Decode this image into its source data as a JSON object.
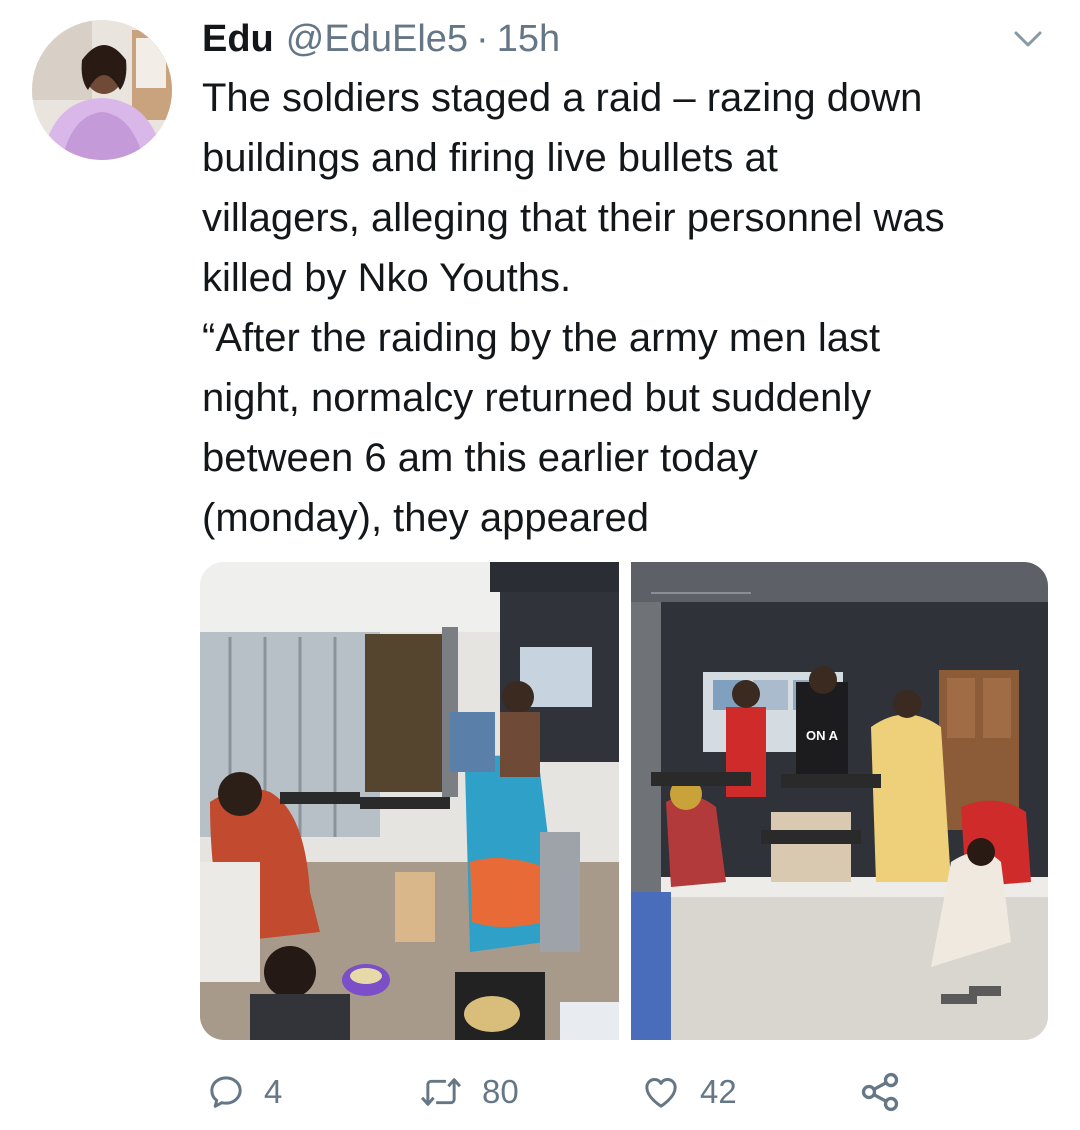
{
  "tweet": {
    "display_name": "Edu",
    "handle": "@EduEle5",
    "separator": "·",
    "time": "15h",
    "lines": [
      "The soldiers staged a raid – razing down",
      "buildings and firing live bullets at",
      "villagers, alleging that their personnel was",
      "killed by Nko Youths.",
      "“After the raiding by the army men last",
      "night, normalcy returned but suddenly",
      "between 6 am this earlier today",
      "(monday), they appeared"
    ]
  },
  "media": {
    "photo_2_shirt_text": "ON A"
  },
  "actions": {
    "reply_count": "4",
    "retweet_count": "80",
    "like_count": "42"
  },
  "icons": {
    "menu": "chevron-down-icon",
    "reply": "reply-icon",
    "retweet": "retweet-icon",
    "like": "heart-icon",
    "share": "share-icon"
  },
  "colors": {
    "text": "#14171a",
    "secondary": "#657786",
    "background": "#ffffff"
  }
}
